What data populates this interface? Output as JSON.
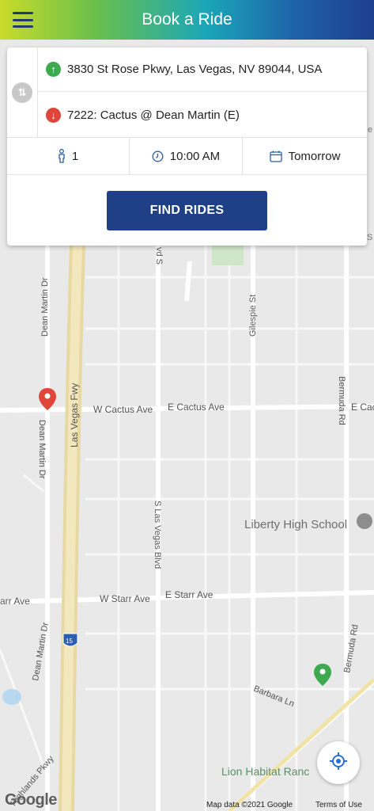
{
  "header": {
    "title": "Book a Ride"
  },
  "trip": {
    "from": "3830 St Rose Pkwy, Las Vegas, NV 89044, USA",
    "to": "7222: Cactus @ Dean Martin (E)",
    "passengers": "1",
    "time": "10:00 AM",
    "date": "Tomorrow"
  },
  "actions": {
    "find_rides": "FIND RIDES"
  },
  "map": {
    "streets": {
      "dean_martin_top": "Dean Martin Dr",
      "dean_martin_mid": "Dean Martin Dr",
      "dean_martin_bottom": "Dean Martin Dr",
      "las_vegas_fwy": "Las Vegas Fwy",
      "s_las_vegas_blvd": "S Las Vegas Blvd",
      "s_las_vegas_top": "vd S",
      "gilespie": "Gilespie St",
      "bermuda_top": "Bermuda Rd",
      "bermuda_bottom": "Bermuda Rd",
      "w_cactus": "W Cactus Ave",
      "e_cactus_1": "E Cactus Ave",
      "e_cactus_2": "E Cac",
      "w_starr": "W Starr Ave",
      "e_starr": "E Starr Ave",
      "starr_left": "arr Ave",
      "barbara": "Barbara Ln",
      "highlands": "Highlands Pkwy",
      "i15": "15"
    },
    "places": {
      "liberty": "Liberty High School",
      "lion": "Lion Habitat Ranc",
      "edge_s": "S",
      "edge_e": "e"
    }
  },
  "attribution": {
    "google": "Google",
    "map_data": "Map data ©2021 Google",
    "terms": "Terms of Use"
  },
  "colors": {
    "header_accent": "#1d3f8c",
    "button": "#1f3f86",
    "origin": "#3eaa4f",
    "destination": "#e0453a"
  }
}
